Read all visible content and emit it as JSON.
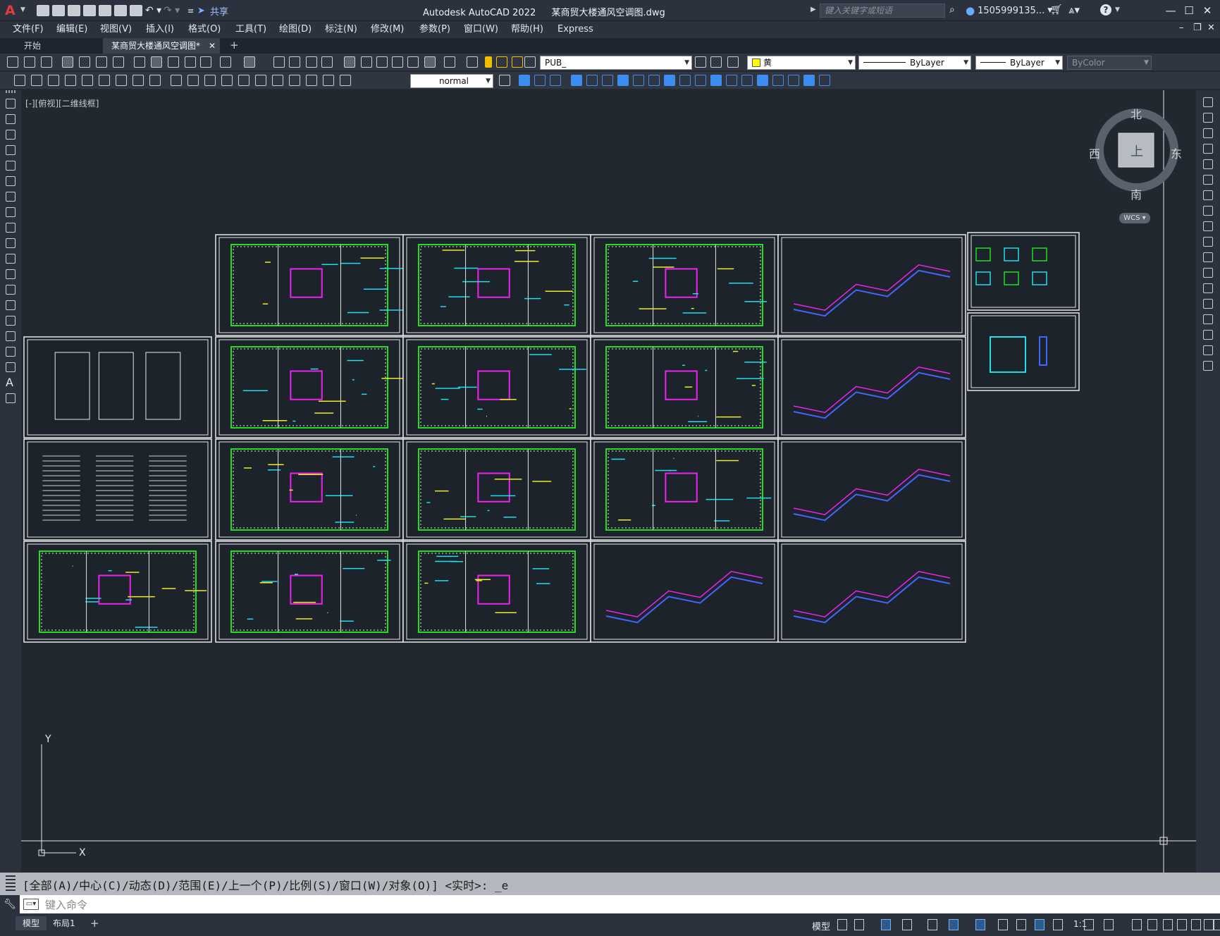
{
  "app": {
    "title": "Autodesk AutoCAD 2022",
    "file": "某商贸大楼通风空调图.dwg",
    "share_label": "共享",
    "search_placeholder": "键入关键字或短语",
    "user": "1505999135...",
    "window_controls": [
      "minimize-icon",
      "maximize-icon",
      "close-icon"
    ]
  },
  "menu": [
    "文件(F)",
    "编辑(E)",
    "视图(V)",
    "插入(I)",
    "格式(O)",
    "工具(T)",
    "绘图(D)",
    "标注(N)",
    "修改(M)",
    "参数(P)",
    "窗口(W)",
    "帮助(H)",
    "Express"
  ],
  "tabs": [
    {
      "label": "开始",
      "active": false
    },
    {
      "label": "某商贸大楼通风空调图*",
      "active": true
    }
  ],
  "properties": {
    "layer": "PUB_",
    "color": "黄",
    "color_hex": "#ffff00",
    "linetype": "ByLayer",
    "lineweight": "ByLayer",
    "plotstyle": "ByColor",
    "dimstyle": "normal"
  },
  "viewport_label": "[-][俯视][二维线框]",
  "viewcube": {
    "north": "北",
    "south": "南",
    "east": "东",
    "west": "西",
    "face": "上",
    "ucs": "WCS"
  },
  "ucs_icon": {
    "x": "X",
    "y": "Y"
  },
  "command": {
    "history": "[全部(A)/中心(C)/动态(D)/范围(E)/上一个(P)/比例(S)/窗口(W)/对象(O)] <实时>: _e",
    "placeholder": "键入命令"
  },
  "status": {
    "layout_tabs": [
      "模型",
      "布局1"
    ],
    "model_label": "模型",
    "scale": "1:1"
  },
  "colors": {
    "bg": "#212830",
    "drawing_green": "#22dd22",
    "drawing_cyan": "#22ddee",
    "drawing_magenta": "#ee22ee",
    "drawing_yellow": "#eeee22",
    "drawing_blue": "#4466ff"
  }
}
